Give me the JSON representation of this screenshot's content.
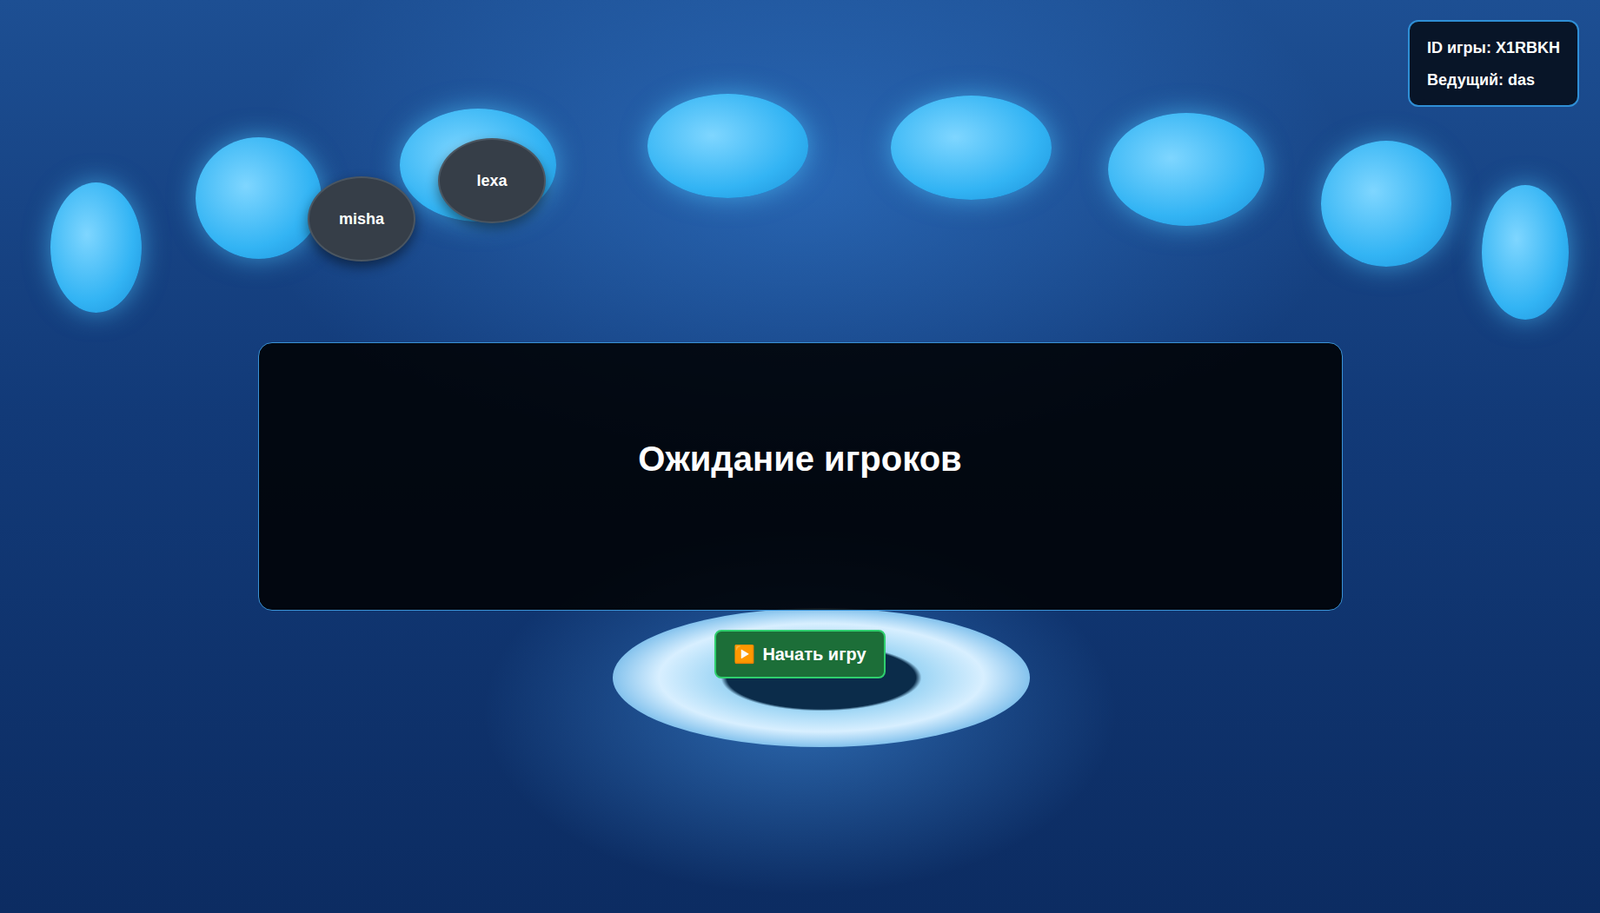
{
  "game": {
    "id_label": "ID игры: X1RBKH",
    "host_label": "Ведущий: das"
  },
  "players": [
    {
      "name": "misha"
    },
    {
      "name": "lexa"
    }
  ],
  "panel": {
    "title": "Ожидание игроков"
  },
  "start_button": {
    "icon": "▶️",
    "label": "Начать игру"
  }
}
